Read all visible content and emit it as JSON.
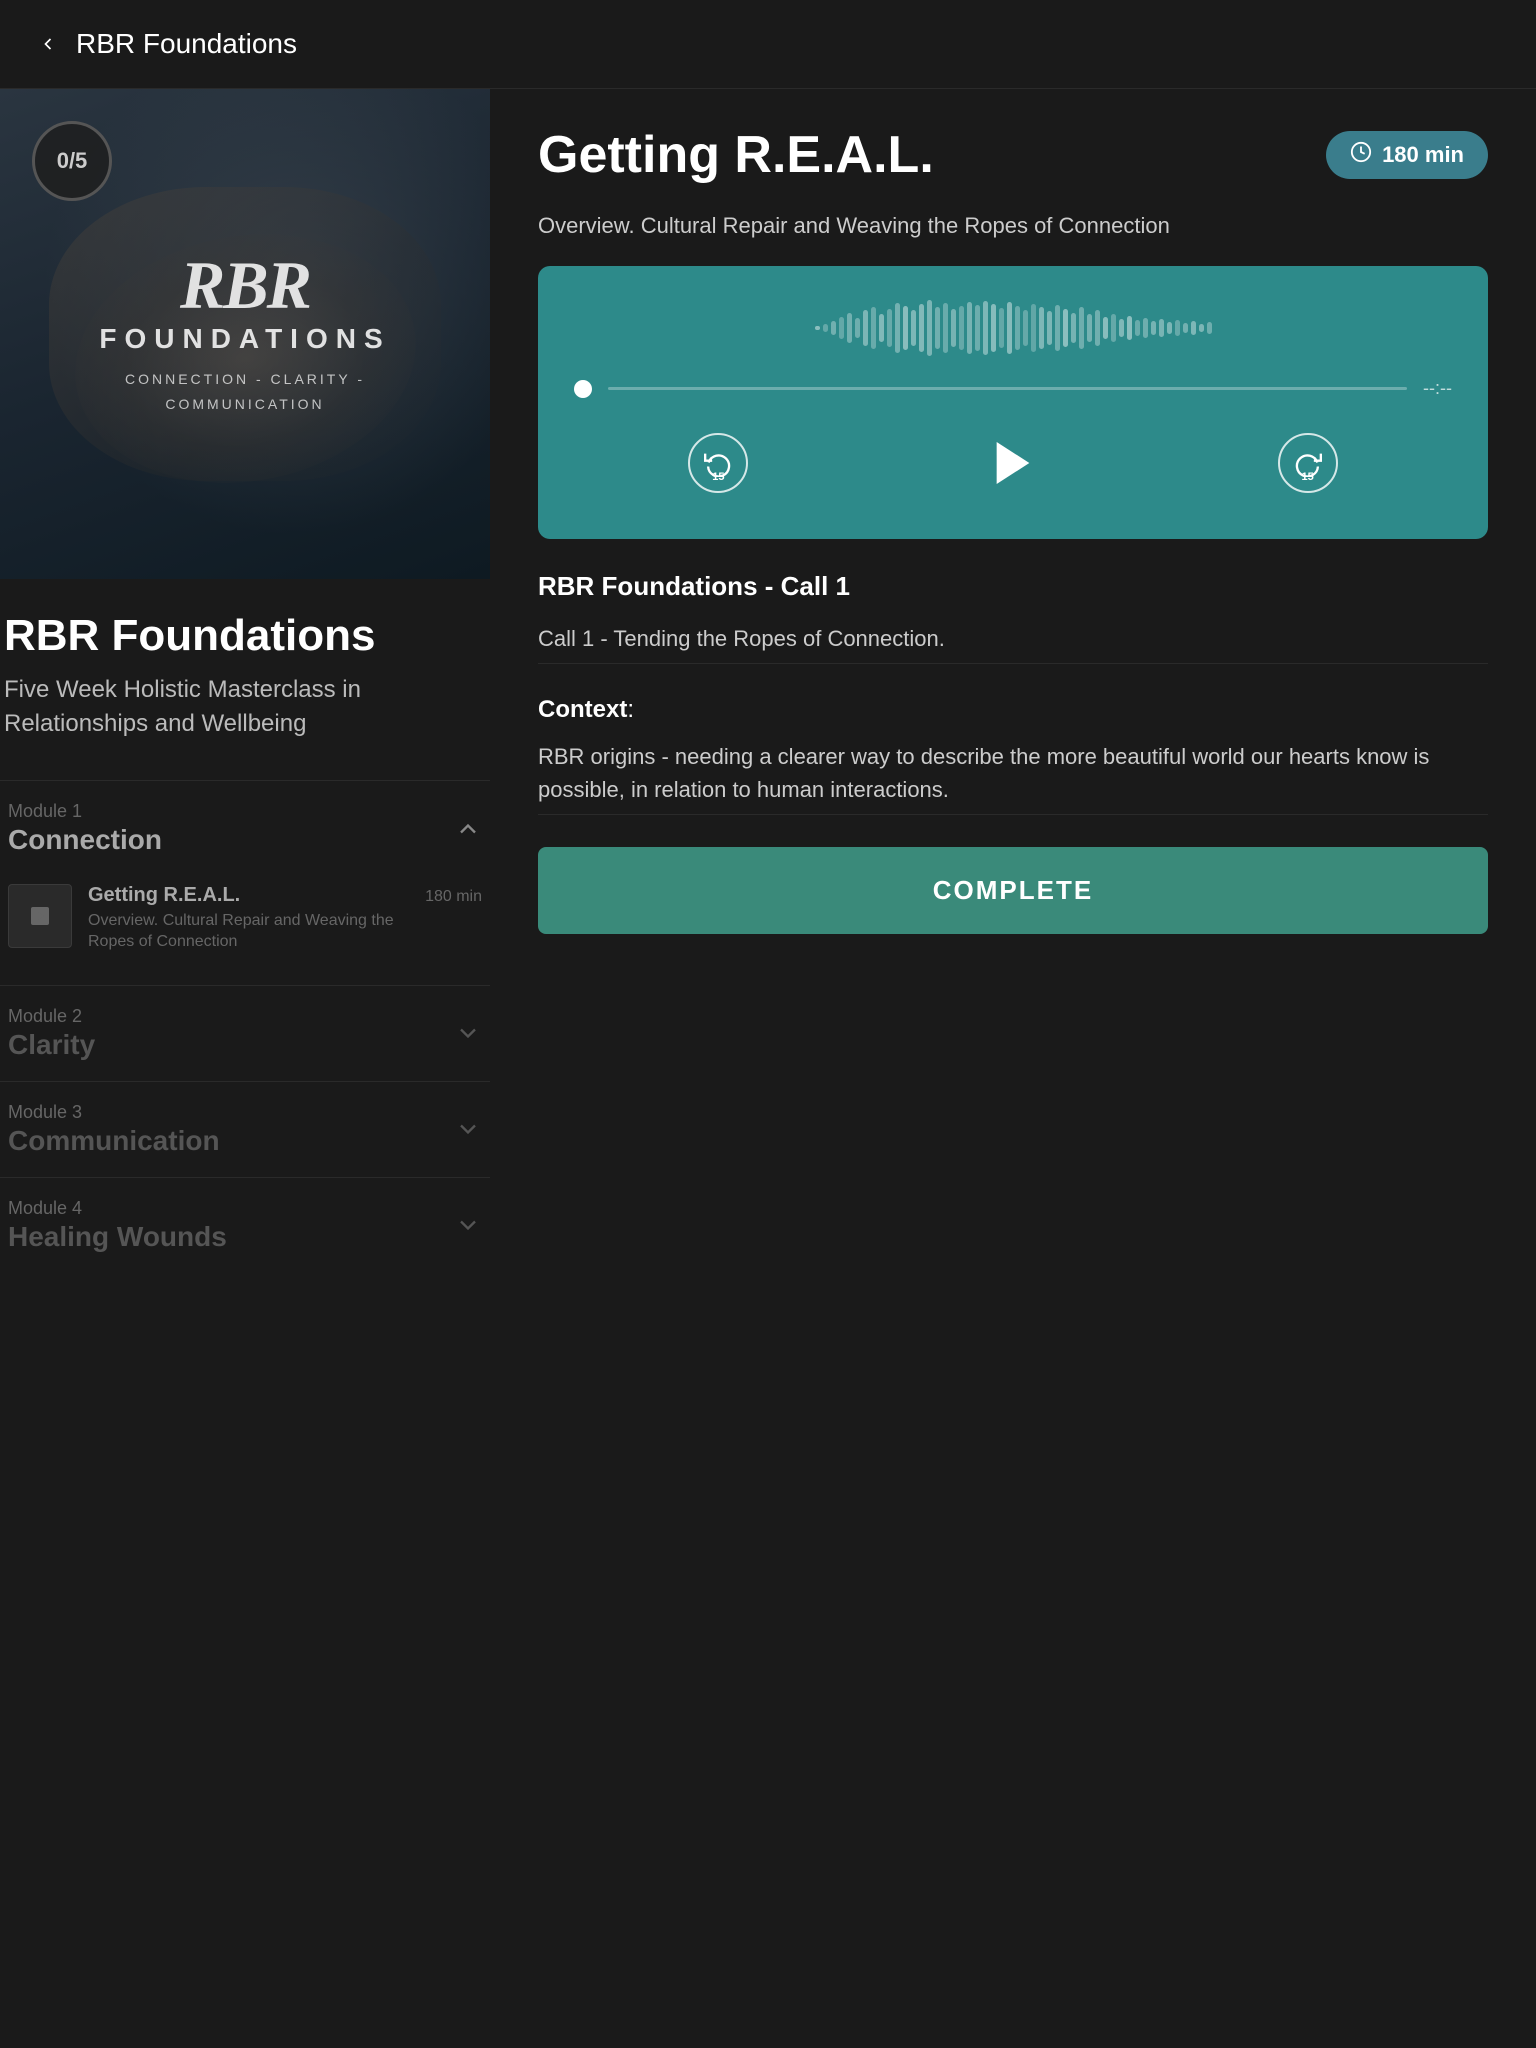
{
  "nav": {
    "back_label": "RBR Foundations"
  },
  "course": {
    "image": {
      "logo_rbr": "RBR",
      "logo_foundations": "FOUNDATIONS",
      "tagline_1": "CONNECTION - CLARITY -",
      "tagline_2": "COMMUNICATION"
    },
    "progress": "0/5",
    "title": "RBR Foundations",
    "subtitle": "Five Week Holistic Masterclass in Relationships and Wellbeing"
  },
  "modules": [
    {
      "id": "module-1",
      "label": "Module 1",
      "title": "Connection",
      "expanded": true,
      "chevron": "up"
    },
    {
      "id": "module-2",
      "label": "Module 2",
      "title": "Clarity",
      "expanded": false,
      "chevron": "down"
    },
    {
      "id": "module-3",
      "label": "Module 3",
      "title": "Communication",
      "expanded": false,
      "chevron": "down"
    },
    {
      "id": "module-4",
      "label": "Module 4",
      "title": "Healing Wounds",
      "expanded": false,
      "chevron": "down"
    }
  ],
  "current_lesson": {
    "title": "Getting R.E.A.L.",
    "duration": "180 min",
    "overview": "Overview. Cultural Repair and Weaving the Ropes of Connection",
    "call_title": "RBR Foundations - Call 1",
    "call_description": "Call 1 - Tending the Ropes of Connection.",
    "context_label": "Context",
    "context_text": "RBR origins - needing a clearer way to describe the more beautiful world our hearts know is possible, in relation to human interactions.",
    "time_display": "--:--"
  },
  "lesson_item": {
    "title": "Getting R.E.A.L.",
    "description": "Overview. Cultural Repair and Weaving the Ropes of Connection",
    "duration": "180 min"
  },
  "player": {
    "rewind_label": "15",
    "forward_label": "15",
    "play_label": "play"
  },
  "complete_button": {
    "label": "COMPLETE"
  },
  "waveform_bars": [
    4,
    8,
    14,
    22,
    30,
    20,
    36,
    42,
    28,
    38,
    50,
    44,
    36,
    48,
    56,
    42,
    50,
    38,
    44,
    52,
    46,
    54,
    48,
    40,
    52,
    44,
    36,
    48,
    42,
    34,
    46,
    38,
    30,
    42,
    28,
    36,
    22,
    28,
    18,
    24,
    16,
    20,
    14,
    18,
    12,
    16,
    10,
    14,
    8,
    12
  ]
}
